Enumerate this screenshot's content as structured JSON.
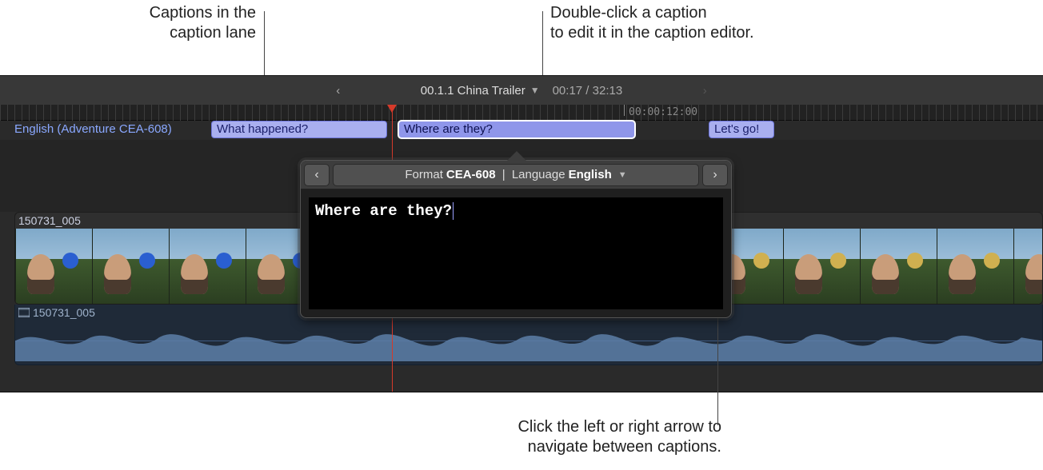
{
  "callouts": {
    "lane": "Captions in the\ncaption lane",
    "editor": "Double-click a caption\nto edit it in the caption editor.",
    "nav": "Click the left or right arrow to\nnavigate between captions."
  },
  "indexbar": {
    "project_title": "00.1.1 China Trailer",
    "position": "00:17",
    "duration": "32:13"
  },
  "ruler": {
    "timecode": "00:00:12:00"
  },
  "caption_lane": {
    "label": "English (Adventure CEA-608)",
    "clips": [
      {
        "text": "What happened?"
      },
      {
        "text": "Where are they?"
      },
      {
        "text": "Let's go!"
      }
    ]
  },
  "video_clip": {
    "name": "150731_005"
  },
  "audio_clip": {
    "name": "150731_005"
  },
  "editor": {
    "format_label": "Format",
    "format_value": "CEA-608",
    "language_label": "Language",
    "language_value": "English",
    "text": "Where are they?"
  }
}
